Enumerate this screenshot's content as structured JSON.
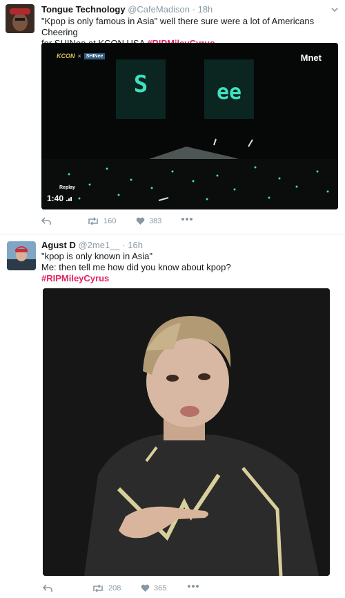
{
  "tweets": [
    {
      "display_name": "Tongue Technology",
      "handle": "@CafeMadison",
      "separator": "·",
      "time": "18h",
      "text_line1": "\"Kpop is only famous in Asia\" well there sure were a lot of Americans Cheering",
      "text_line2": "for SHINee at KCON USA",
      "hashtag": "#RIPMileyCyrus",
      "video": {
        "overlay_replay": "Replay",
        "duration": "1:40",
        "channel_logo": "Mnet",
        "stage_letters_left": "S",
        "stage_letters_right": "ee",
        "banner_left": "KCON",
        "banner_right": "SHINee"
      },
      "actions": {
        "retweets": "160",
        "likes": "383"
      }
    },
    {
      "display_name": "Agust D",
      "handle": "@2me1__",
      "separator": "·",
      "time": "16h",
      "text_line1": "\"kpop is only known in Asia\"",
      "text_line2": "Me: then tell me how did you know about kpop?",
      "hashtag": "#RIPMileyCyrus",
      "actions": {
        "retweets": "208",
        "likes": "365"
      }
    }
  ],
  "colors": {
    "hashtag": "#e0245e",
    "muted": "#8899a6",
    "divider": "#e1e8ed"
  },
  "icons": [
    "reply-icon",
    "retweet-icon",
    "heart-icon",
    "more-icon",
    "chevron-down-icon",
    "signal-icon"
  ]
}
